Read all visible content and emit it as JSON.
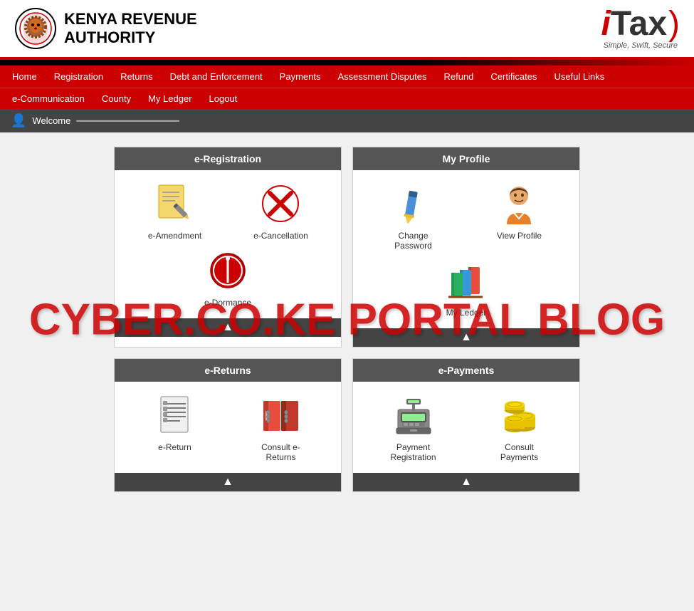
{
  "header": {
    "kra_name_line1": "Kenya Revenue",
    "kra_name_line2": "Authority",
    "itax_brand": "iTax",
    "itax_tagline": "Simple, Swift, Secure"
  },
  "nav_top": {
    "items": [
      {
        "label": "Home",
        "id": "home"
      },
      {
        "label": "Registration",
        "id": "registration"
      },
      {
        "label": "Returns",
        "id": "returns"
      },
      {
        "label": "Debt and Enforcement",
        "id": "debt"
      },
      {
        "label": "Payments",
        "id": "payments"
      },
      {
        "label": "Assessment Disputes",
        "id": "assessment"
      },
      {
        "label": "Refund",
        "id": "refund"
      },
      {
        "label": "Certificates",
        "id": "certificates"
      },
      {
        "label": "Useful Links",
        "id": "useful"
      }
    ]
  },
  "nav_bottom": {
    "items": [
      {
        "label": "e-Communication",
        "id": "ecomm"
      },
      {
        "label": "County",
        "id": "county"
      },
      {
        "label": "My Ledger",
        "id": "ledger"
      },
      {
        "label": "Logout",
        "id": "logout"
      }
    ]
  },
  "welcome": {
    "label": "Welcome"
  },
  "eregistration": {
    "title": "e-Registration",
    "items": [
      {
        "label": "e-Amendment",
        "icon": "📝",
        "id": "amendment"
      },
      {
        "label": "e-Cancellation",
        "icon": "❌",
        "id": "cancellation"
      },
      {
        "label": "e-Dormance",
        "icon": "🚫",
        "id": "dormance"
      }
    ]
  },
  "myprofile": {
    "title": "My Profile",
    "items": [
      {
        "label": "Change Password",
        "icon": "✏️",
        "id": "changepass"
      },
      {
        "label": "View Profile",
        "icon": "👤",
        "id": "viewprofile"
      },
      {
        "label": "My Ledger",
        "icon": "📚",
        "id": "myledger"
      }
    ]
  },
  "ereturns": {
    "title": "e-Returns",
    "items": [
      {
        "label": "e-Return",
        "icon": "📄",
        "id": "ereturn"
      },
      {
        "label": "Consult e-Returns",
        "icon": "📁",
        "id": "consultereturn"
      }
    ]
  },
  "epayments": {
    "title": "e-Payments",
    "items": [
      {
        "label": "Payment Registration",
        "icon": "💳",
        "id": "paymentreg"
      },
      {
        "label": "Consult Payments",
        "icon": "💰",
        "id": "consultpay"
      }
    ]
  },
  "watermark": {
    "text": "CYBER.CO.KE PORTAL BLOG"
  }
}
